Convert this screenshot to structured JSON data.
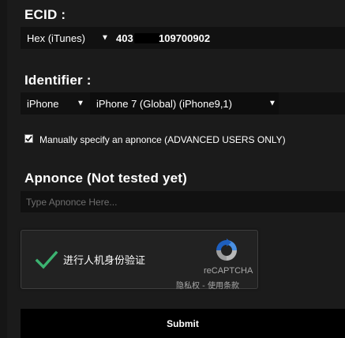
{
  "ecid": {
    "heading": "ECID :",
    "format_select": "Hex (iTunes)",
    "value_prefix": "403",
    "value_suffix": "109700902"
  },
  "identifier": {
    "heading": "Identifier :",
    "device_type_select": "iPhone",
    "model_select": "iPhone 7 (Global) (iPhone9,1)"
  },
  "apnonce_option": {
    "checked": true,
    "label": "Manually specify an apnonce (ADVANCED USERS ONLY)"
  },
  "apnonce": {
    "heading": "Apnonce (Not tested yet)",
    "placeholder": "Type Apnonce Here..."
  },
  "recaptcha": {
    "label": "进行人机身份验证",
    "brand": "reCAPTCHA",
    "links": "隐私权 - 使用条款",
    "check_color": "#3cb371"
  },
  "submit": {
    "label": "Submit"
  },
  "icons": {
    "select_caret": "caret-down-icon",
    "checkbox": "checkmark-icon",
    "recaptcha_check": "green-checkmark-icon",
    "recaptcha_logo": "recaptcha-logo-icon"
  }
}
